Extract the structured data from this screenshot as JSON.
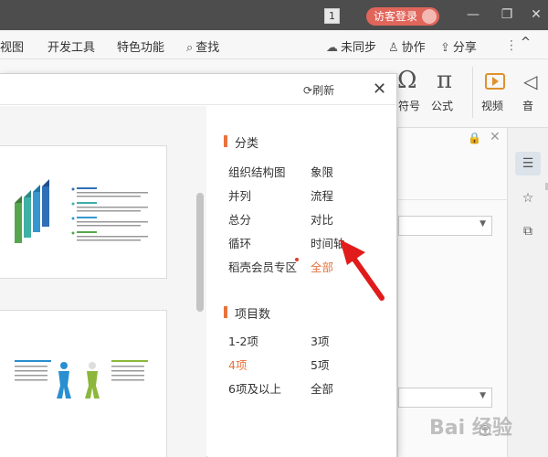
{
  "titlebar": {
    "badge": "1",
    "login_label": "访客登录",
    "minimize": "—",
    "restore": "❐",
    "close": "✕"
  },
  "menubar": {
    "items": [
      "视图",
      "开发工具",
      "特色功能",
      "查找"
    ],
    "right_items": [
      "未同步",
      "协作",
      "分享"
    ],
    "overflow": "⋮",
    "collapse": "^"
  },
  "ribbon": {
    "symbol_label": "符号",
    "formula_label": "公式",
    "video_label": "视频",
    "audio_label": "音"
  },
  "dialog": {
    "refresh_label": "刷新",
    "close_label": "✕",
    "category_section": {
      "title": "分类",
      "items": [
        {
          "label": "组织结构图",
          "selected": false
        },
        {
          "label": "象限",
          "selected": false
        },
        {
          "label": "并列",
          "selected": false
        },
        {
          "label": "流程",
          "selected": false
        },
        {
          "label": "总分",
          "selected": false
        },
        {
          "label": "对比",
          "selected": false
        },
        {
          "label": "循环",
          "selected": false
        },
        {
          "label": "时间轴",
          "selected": false
        },
        {
          "label": "稻壳会员专区",
          "selected": false,
          "badge_dot": true
        },
        {
          "label": "全部",
          "selected": true
        }
      ]
    },
    "count_section": {
      "title": "项目数",
      "items": [
        {
          "label": "1-2项",
          "selected": false
        },
        {
          "label": "3项",
          "selected": false
        },
        {
          "label": "4项",
          "selected": true
        },
        {
          "label": "5项",
          "selected": false
        },
        {
          "label": "6项及以上",
          "selected": false
        },
        {
          "label": "全部",
          "selected": false
        }
      ]
    }
  },
  "colors": {
    "accent": "#e8733e",
    "login_pill": "#e0655b",
    "arrow": "#e11b1b",
    "titlebar": "#4d4d4d"
  },
  "watermark": "Bai 经验"
}
